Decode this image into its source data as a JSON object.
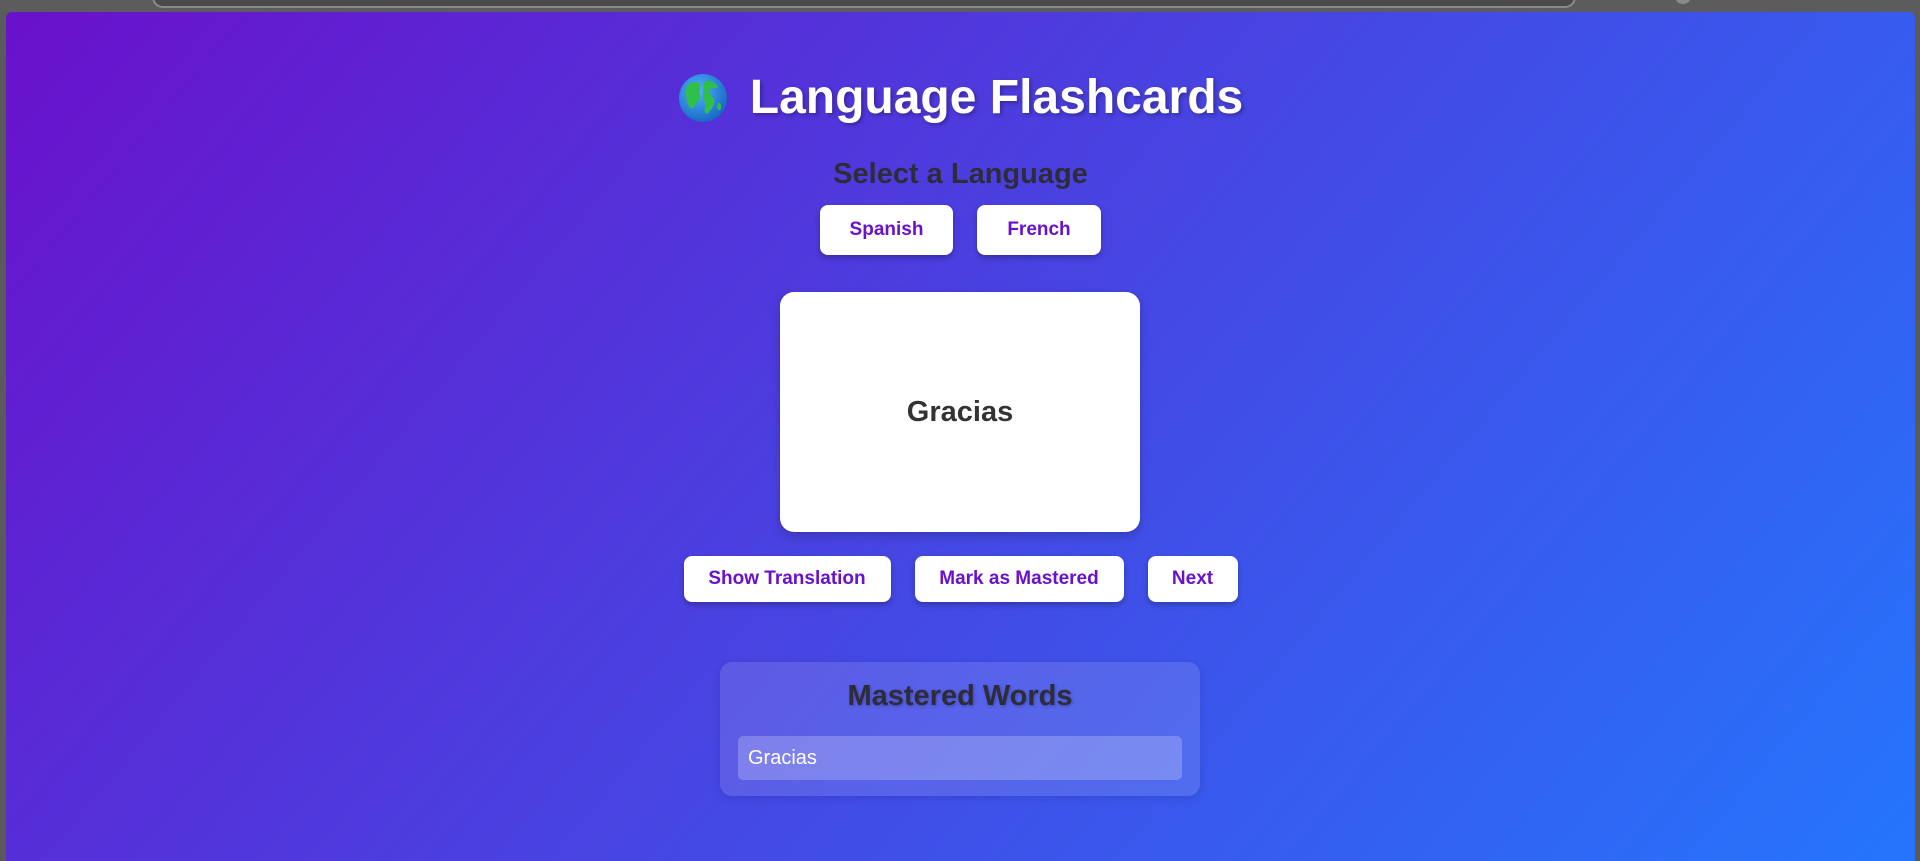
{
  "app": {
    "title": "Language Flashcards",
    "title_icon": "globe-icon"
  },
  "language_select": {
    "heading": "Select a Language",
    "options": [
      {
        "label": "Spanish"
      },
      {
        "label": "French"
      }
    ]
  },
  "flashcard": {
    "word": "Gracias"
  },
  "actions": {
    "show_translation": "Show Translation",
    "mark_mastered": "Mark as Mastered",
    "next": "Next"
  },
  "mastered": {
    "heading": "Mastered Words",
    "items": [
      "Gracias"
    ]
  },
  "colors": {
    "gradient_start": "#6a11cb",
    "gradient_end": "#2575fc",
    "button_text": "#6a11cb",
    "button_bg": "#ffffff"
  }
}
